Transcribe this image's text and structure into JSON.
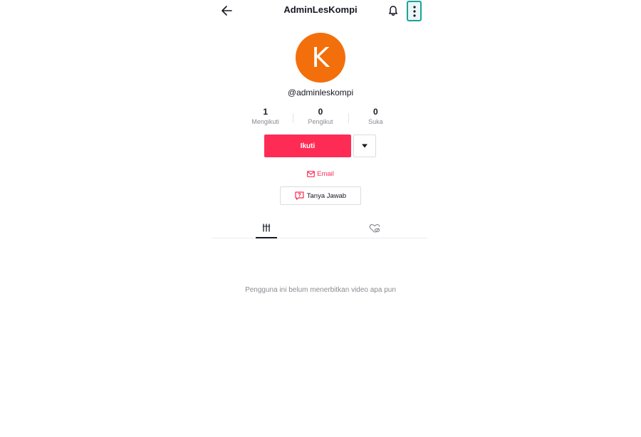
{
  "header": {
    "title": "AdminLesKompi",
    "back_icon": "arrow-left-icon",
    "notification_icon": "bell-icon",
    "menu_icon": "vertical-dots-icon"
  },
  "profile": {
    "avatar_initial": "K",
    "avatar_color": "#f36f0b",
    "username": "@adminleskompi"
  },
  "stats": [
    {
      "value": "1",
      "label": "Mengikuti"
    },
    {
      "value": "0",
      "label": "Pengikut"
    },
    {
      "value": "0",
      "label": "Suka"
    }
  ],
  "actions": {
    "follow_label": "Ikuti",
    "follow_color": "#fe2c55",
    "email_label": "Email",
    "qa_label": "Tanya Jawab"
  },
  "tabs": [
    {
      "icon": "videos-grid-icon",
      "active": true
    },
    {
      "icon": "liked-hidden-icon",
      "active": false
    }
  ],
  "empty_state": "Pengguna ini belum menerbitkan video apa pun"
}
